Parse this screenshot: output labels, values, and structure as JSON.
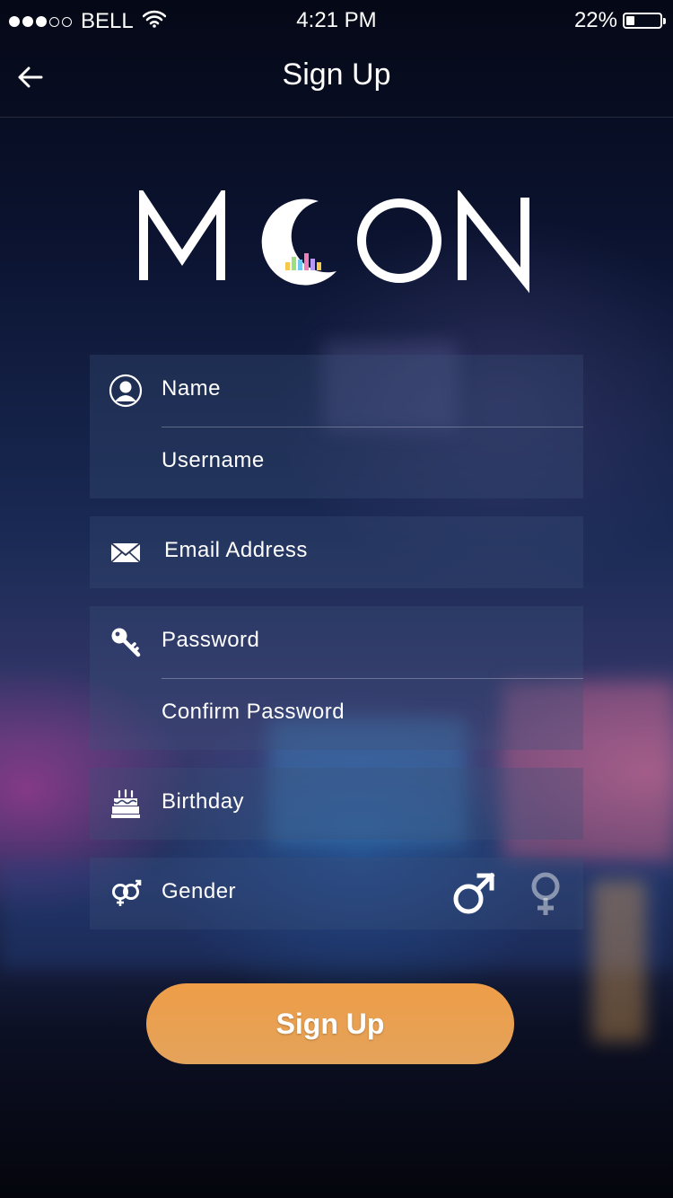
{
  "status_bar": {
    "carrier": "BELL",
    "time": "4:21 PM",
    "battery": "22%",
    "battery_level": 0.22,
    "signal_icon": "signal-dots-icon",
    "wifi_icon": "wifi-icon",
    "battery_icon": "battery-icon"
  },
  "nav": {
    "back_icon": "back-arrow-icon",
    "title": "Sign Up"
  },
  "logo": {
    "text": "MOON"
  },
  "form": {
    "name": {
      "placeholder": "Name",
      "icon": "user-icon"
    },
    "username": {
      "placeholder": "Username"
    },
    "email": {
      "placeholder": "Email Address",
      "icon": "envelope-icon"
    },
    "password": {
      "placeholder": "Password",
      "icon": "key-icon"
    },
    "confirm_password": {
      "placeholder": "Confirm Password"
    },
    "birthday": {
      "placeholder": "Birthday",
      "icon": "cake-icon"
    },
    "gender": {
      "label": "Gender",
      "icon": "gender-icon",
      "options": [
        {
          "value": "male",
          "icon": "male-icon",
          "selected": true
        },
        {
          "value": "female",
          "icon": "female-icon",
          "selected": false
        }
      ]
    }
  },
  "signup_button": {
    "label": "Sign Up"
  },
  "colors": {
    "accent": "#ec9d4a",
    "panel": "rgba(60,80,120,0.32)",
    "text": "#ffffff"
  }
}
